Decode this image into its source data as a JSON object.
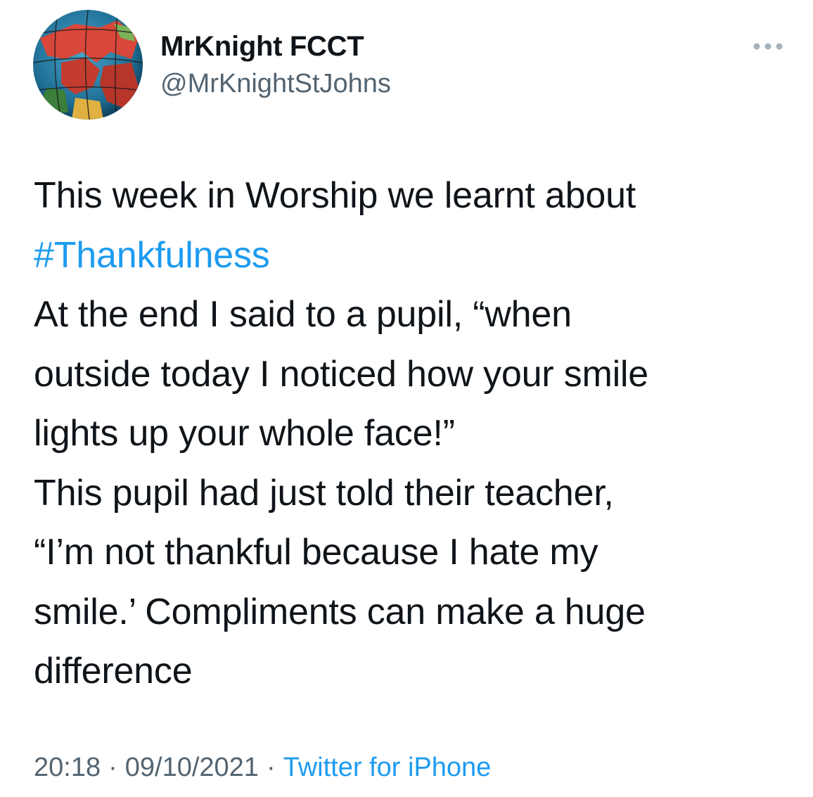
{
  "author": {
    "display_name": "MrKnight FCCT",
    "handle": "@MrKnightStJohns",
    "avatar_icon": "globe-map-avatar"
  },
  "menu": {
    "more_icon": "more-horizontal-icon"
  },
  "tweet": {
    "lines": [
      "This week in Worship we learnt about",
      "#Thankfulness",
      "At the end I said to a pupil, “when",
      "outside today I noticed how your smile",
      "lights up your whole face!”",
      "This pupil had just told their teacher,",
      "“I’m not thankful because I hate my",
      "smile.’ Compliments can make a huge",
      "difference"
    ]
  },
  "meta": {
    "time": "20:18",
    "separator": "·",
    "date": "09/10/2021",
    "source": "Twitter for iPhone"
  },
  "colors": {
    "text": "#0f1419",
    "secondary": "#536471",
    "link": "#1d9bf0"
  }
}
